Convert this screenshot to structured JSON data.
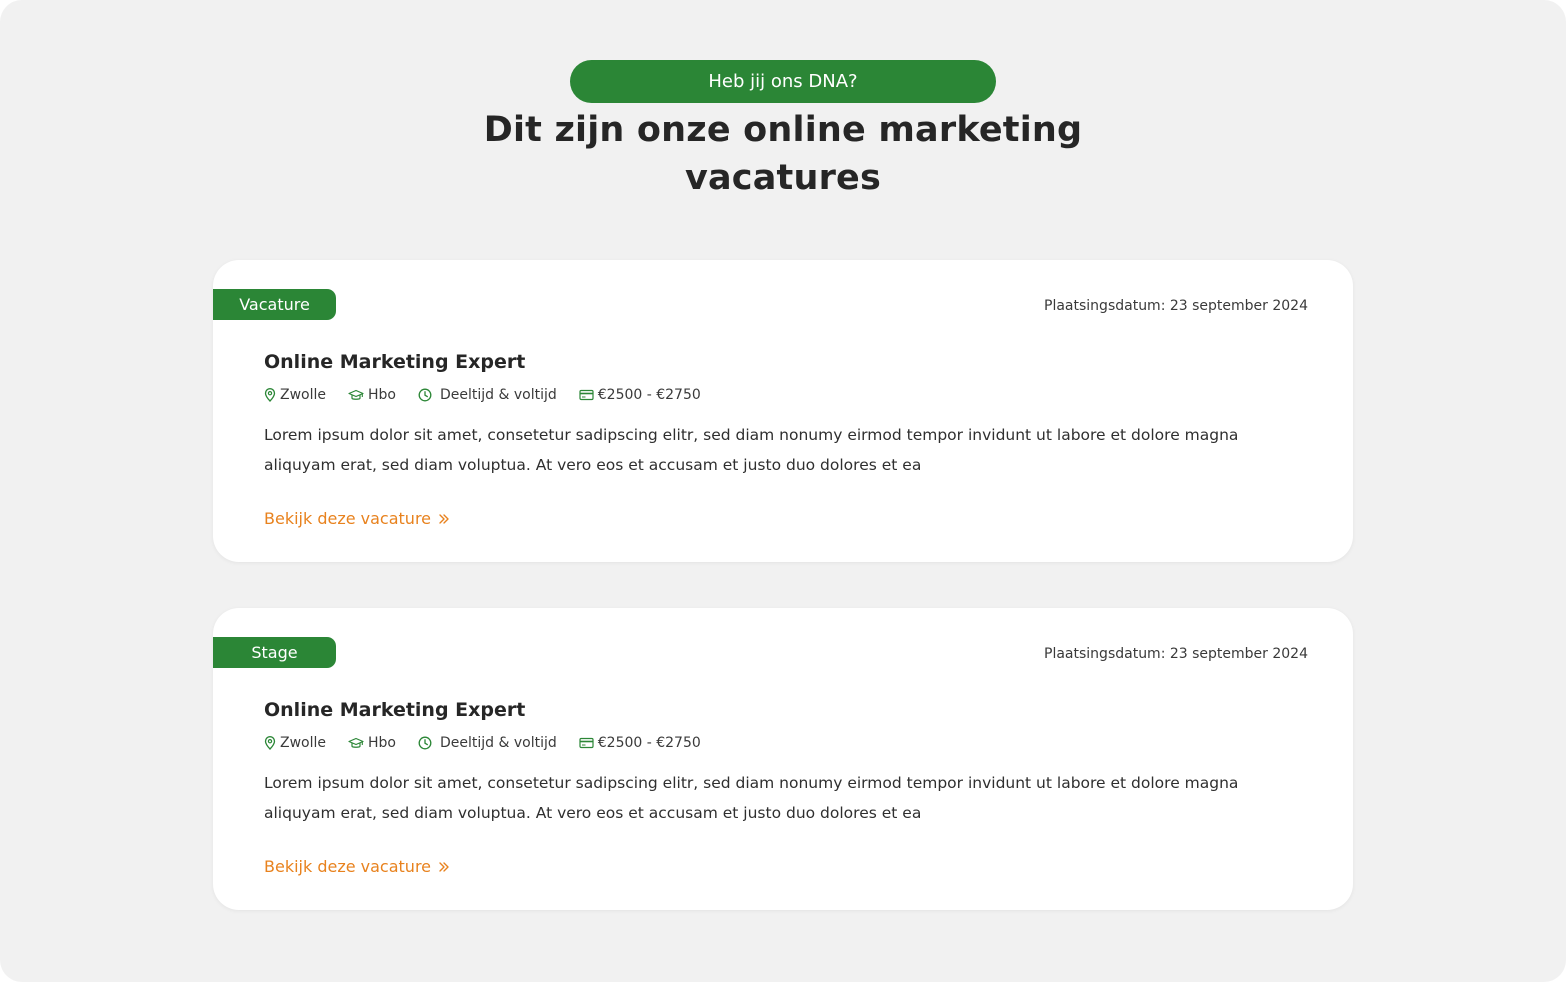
{
  "header": {
    "eyebrow": "Heb jij ons DNA?",
    "title_line1": "Dit zijn onze online marketing",
    "title_line2": "vacatures"
  },
  "colors": {
    "brand_green": "#2b8636",
    "link_orange": "#e8821e",
    "background": "#f1f1f1"
  },
  "icons": {
    "location": "map-pin-icon",
    "education": "graduation-cap-icon",
    "hours": "clock-icon",
    "salary": "credit-card-icon",
    "link": "double-chevron-right-icon"
  },
  "jobs": [
    {
      "tag": "Vacature",
      "date": "Plaatsingsdatum: 23 september 2024",
      "title": "Online Marketing Expert",
      "location": "Zwolle",
      "education": "Hbo",
      "hours": "Deeltijd & voltijd",
      "salary": "€2500 - €2750",
      "description": "Lorem ipsum dolor sit amet, consetetur sadipscing elitr, sed diam nonumy eirmod tempor invidunt ut labore et dolore magna aliquyam erat, sed diam voluptua. At vero eos et accusam et justo duo dolores et ea",
      "link": "Bekijk deze vacature"
    },
    {
      "tag": "Stage",
      "date": "Plaatsingsdatum: 23 september 2024",
      "title": "Online Marketing Expert",
      "location": "Zwolle",
      "education": "Hbo",
      "hours": "Deeltijd & voltijd",
      "salary": "€2500 - €2750",
      "description": "Lorem ipsum dolor sit amet, consetetur sadipscing elitr, sed diam nonumy eirmod tempor invidunt ut labore et dolore magna aliquyam erat, sed diam voluptua. At vero eos et accusam et justo duo dolores et ea",
      "link": "Bekijk deze vacature"
    }
  ]
}
